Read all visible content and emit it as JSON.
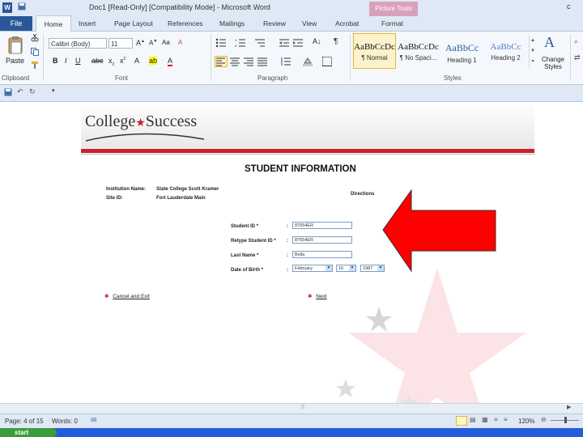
{
  "window": {
    "title": "Doc1 [Read-Only] [Compatibility Mode] - Microsoft Word",
    "context_group": "Picture Tools",
    "app_icon": "W",
    "controls": "c"
  },
  "tabs": {
    "file": "File",
    "items": [
      "Home",
      "Insert",
      "Page Layout",
      "References",
      "Mailings",
      "Review",
      "View",
      "Acrobat"
    ],
    "context_tab": "Format"
  },
  "ribbon": {
    "clipboard": {
      "paste_label": "Paste",
      "group_label": "Clipboard"
    },
    "font": {
      "font_name": "Calibri (Body)",
      "font_size": "11",
      "group_label": "Font"
    },
    "paragraph": {
      "group_label": "Paragraph"
    },
    "styles": {
      "group_label": "Styles",
      "items": [
        {
          "preview": "AaBbCcDc",
          "name": "¶ Normal"
        },
        {
          "preview": "AaBbCcDc",
          "name": "¶ No Spaci..."
        },
        {
          "preview": "AaBbCc",
          "name": "Heading 1"
        },
        {
          "preview": "AaBbCc",
          "name": "Heading 2"
        }
      ],
      "change_styles": "Change Styles"
    }
  },
  "document": {
    "logo_text_1": "College",
    "logo_text_2": "Success",
    "heading": "STUDENT INFORMATION",
    "institution_label": "Institution Name:",
    "institution_value": "State College Scott Kramer",
    "site_label": "Site ID:",
    "site_value": "Fort Lauderdale Main",
    "directions": "Directions",
    "student_id_label": "Student ID *",
    "student_id_value": "87654ER",
    "retype_label": "Retype Student ID *",
    "retype_value": "87654ER",
    "last_name_label": "Last Name *",
    "last_name_value": "Bella",
    "dob_label": "Date of Birth *",
    "dob_month": "February",
    "dob_day": "16",
    "dob_year": "1987",
    "colon": ":",
    "cancel_link": "Cancel and Exit",
    "next_link": "Next"
  },
  "status": {
    "page": "Page: 4 of 15",
    "words": "Words: 0",
    "zoom": "120%"
  },
  "taskbar": {
    "start_label": "start"
  },
  "colors": {
    "accent_blue": "#2b579a",
    "arrow_red": "#ff0000",
    "brand_red": "#c8202f"
  }
}
